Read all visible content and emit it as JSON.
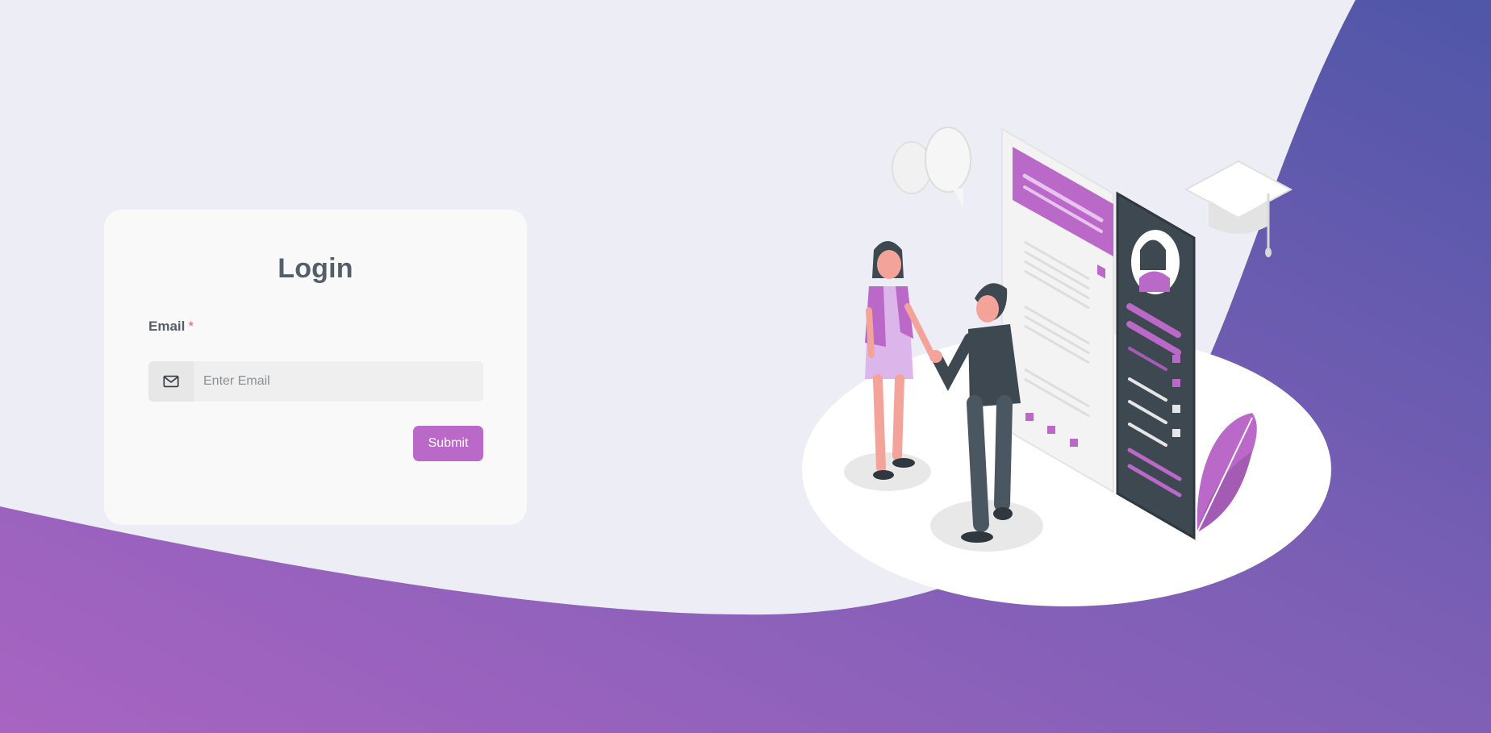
{
  "login": {
    "title": "Login",
    "email_label": "Email",
    "required_mark": "*",
    "email_placeholder": "Enter Email",
    "email_value": "",
    "email_icon": "mail-icon",
    "submit_label": "Submit"
  },
  "colors": {
    "background": "#ededf6",
    "card": "#f9f9f9",
    "accent": "#ba69c9",
    "wave_left": "#a864c2",
    "wave_right": "#4f56a8",
    "text": "#555e6b",
    "required": "#e35b6b"
  },
  "illustration": {
    "subject": "handshake-resume-illustration",
    "icons": [
      "speech-bubbles-icon",
      "graduation-cap-icon",
      "plant-leaf-icon",
      "resume-document-icon",
      "phone-profile-icon"
    ]
  }
}
